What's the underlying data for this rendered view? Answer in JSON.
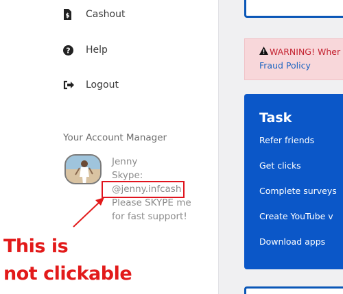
{
  "sidebar": {
    "nav": [
      {
        "label": "Cashout",
        "icon": "money-bill-icon"
      },
      {
        "label": "Help",
        "icon": "question-circle-icon"
      },
      {
        "label": "Logout",
        "icon": "sign-out-icon"
      }
    ],
    "account_manager": {
      "heading": "Your Account Manager",
      "name": "Jenny",
      "skype_label": "Skype:",
      "skype_handle": "@jenny.infcash",
      "note_line1": "Please SKYPE me",
      "note_line2": "for fast support!"
    }
  },
  "annotation": {
    "line1": "This is",
    "line2": "not clickable",
    "color": "#e21a1a"
  },
  "main": {
    "warning": {
      "prefix": "WARNING! Wher",
      "link": "Fraud Policy"
    },
    "task": {
      "title": "Task",
      "items": [
        "Refer friends",
        "Get clicks",
        "Complete surveys",
        "Create YouTube v",
        "Download apps"
      ]
    }
  },
  "colors": {
    "accent_blue": "#0b57c8",
    "warning_bg": "#f8d7da",
    "warning_text": "#c42230",
    "link": "#1f66c1"
  }
}
